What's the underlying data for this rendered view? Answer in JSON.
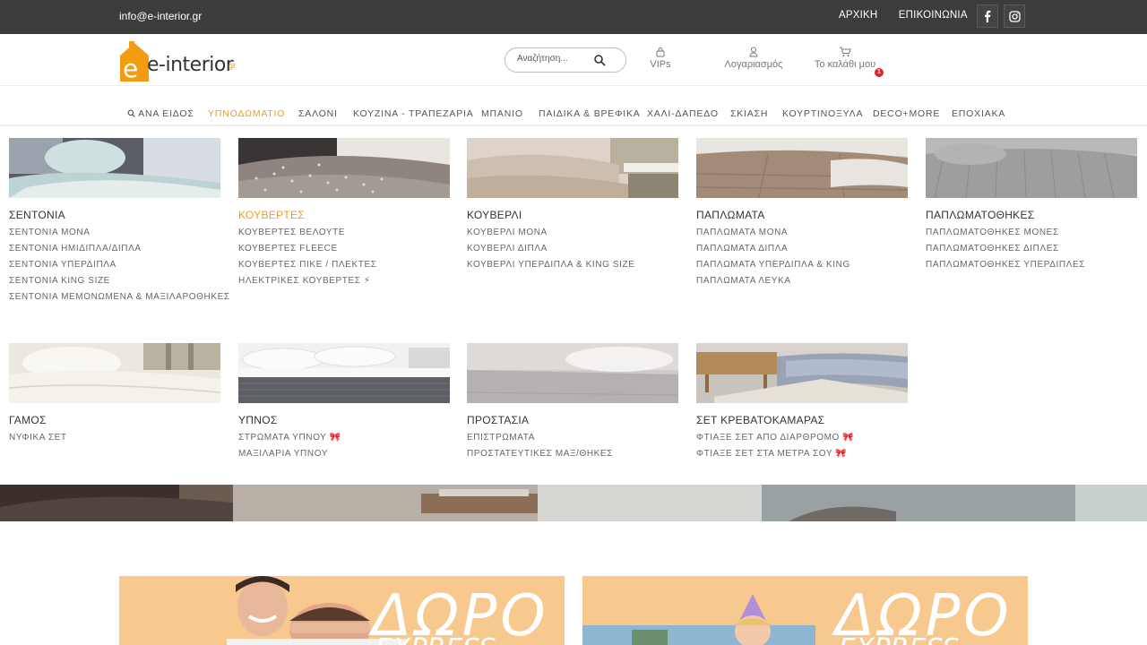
{
  "topbar": {
    "email": "info@e-interior.gr",
    "links": [
      "ΑΡΧΙΚΗ",
      "ΕΠΙΚΟΙΝΩΝΙΑ"
    ],
    "social": [
      "facebook-icon",
      "instagram-icon"
    ]
  },
  "header": {
    "logo_text": "e-interior",
    "logo_suffix": "gr",
    "search_placeholder": "Αναζήτηση...",
    "vips_label": "VIPs",
    "account_label": "Λογαριασμός",
    "cart_label": "Το καλάθι μου",
    "cart_count": "1"
  },
  "colors": {
    "accent": "#f39c12",
    "topbar": "#3c3c3c",
    "promo": "#f7c98f",
    "badge": "#d9262c"
  },
  "nav": {
    "items": [
      "ΑΝΑ ΕΙΔΟΣ",
      "ΥΠΝΟΔΩΜΑΤΙΟ",
      "ΣΑΛΟΝΙ",
      "ΚΟΥΖΙΝΑ - ΤΡΑΠΕΖΑΡΙΑ",
      "ΜΠΑΝΙΟ",
      "ΠΑΙΔΙΚΑ & ΒΡΕΦΙΚΑ",
      "ΧΑΛΙ-ΔΑΠΕΔΟ",
      "ΣΚΙΑΣΗ",
      "ΚΟΥΡΤΙΝΟΞΥΛΑ",
      "DECO+MORE",
      "ΕΠΟΧΙΑΚΑ"
    ],
    "active": "ΥΠΝΟΔΩΜΑΤΙΟ"
  },
  "mega": {
    "columns": [
      {
        "title": "ΣΕΝΤΟΝΙΑ",
        "items": [
          "ΣΕΝΤΟΝΙΑ ΜΟΝΑ",
          "ΣΕΝΤΟΝΙΑ ΗΜΙΔΙΠΛΑ/ΔΙΠΛΑ",
          "ΣΕΝΤΟΝΙΑ ΥΠΕΡΔΙΠΛΑ",
          "ΣΕΝΤΟΝΙΑ KING SIZE",
          "ΣΕΝΤΟΝΙΑ ΜΕΜΟΝΩΜΕΝΑ & ΜΑΞΙΛΑΡΟΘΗΚΕΣ"
        ]
      },
      {
        "title": "ΚΟΥΒΕΡΤΕΣ",
        "items": [
          "ΚΟΥΒΕΡΤΕΣ ΒΕΛΟΥΤΕ",
          "ΚΟΥΒΕΡΤΕΣ FLEECE",
          "ΚΟΥΒΕΡΤΕΣ ΠΙΚΕ / ΠΛΕΚΤΕΣ",
          "ΗΛΕΚΤΡΙΚΕΣ ΚΟΥΒΕΡΤΕΣ ⚡"
        ]
      },
      {
        "title": "ΚΟΥΒΕΡΛΙ",
        "items": [
          "ΚΟΥΒΕΡΛΙ ΜΟΝΑ",
          "ΚΟΥΒΕΡΛΙ ΔΙΠΛΑ",
          "ΚΟΥΒΕΡΛΙ ΥΠΕΡΔΙΠΛΑ & KING SIZE"
        ]
      },
      {
        "title": "ΠΑΠΛΩΜΑΤΑ",
        "items": [
          "ΠΑΠΛΩΜΑΤΑ ΜΟΝΑ",
          "ΠΑΠΛΩΜΑΤΑ ΔΙΠΛΑ",
          "ΠΑΠΛΩΜΑΤΑ ΥΠΕΡΔΙΠΛΑ & KING",
          "ΠΑΠΛΩΜΑΤΑ ΛΕΥΚΑ"
        ]
      },
      {
        "title": "ΠΑΠΛΩΜΑΤΟΘΗΚΕΣ",
        "items": [
          "ΠΑΠΛΩΜΑΤΟΘΗΚΕΣ ΜΟΝΕΣ",
          "ΠΑΠΛΩΜΑΤΟΘΗΚΕΣ ΔΙΠΛΕΣ",
          "ΠΑΠΛΩΜΑΤΟΘΗΚΕΣ ΥΠΕΡΔΙΠΛΕΣ"
        ]
      },
      {
        "title": "ΓΑΜΟΣ",
        "items": [
          "ΝΥΦΙΚΑ ΣΕΤ"
        ]
      },
      {
        "title": "ΥΠΝΟΣ",
        "items": [
          "ΣΤΡΩΜΑΤΑ ΥΠΝΟΥ 🎀",
          "ΜΑΞΙΛΑΡΙΑ ΥΠΝΟΥ"
        ]
      },
      {
        "title": "ΠΡΟΣΤΑΣΙΑ",
        "items": [
          "ΕΠΙΣΤΡΩΜΑΤΑ",
          "ΠΡΟΣΤΑΤΕΥΤΙΚΕΣ ΜΑΞ/ΘΗΚΕΣ"
        ]
      },
      {
        "title": "ΣΕΤ ΚΡΕΒΑΤΟΚΑΜΑΡΑΣ",
        "items": [
          "ΦΤΙΑΞΕ ΣΕΤ ΑΠΟ ΔΙΑΡΘΡΟΜΟ 🎀",
          "ΦΤΙΑΞΕ ΣΕΤ ΣΤΑ ΜΕΤΡΑ ΣΟΥ 🎀"
        ]
      }
    ],
    "active_title": "ΚΟΥΒΕΡΤΕΣ"
  },
  "promos": [
    {
      "big": "ΔΩΡΟ",
      "small": "EXPRESS"
    },
    {
      "big": "ΔΩΡΟ",
      "small": "EXPRESS"
    }
  ]
}
